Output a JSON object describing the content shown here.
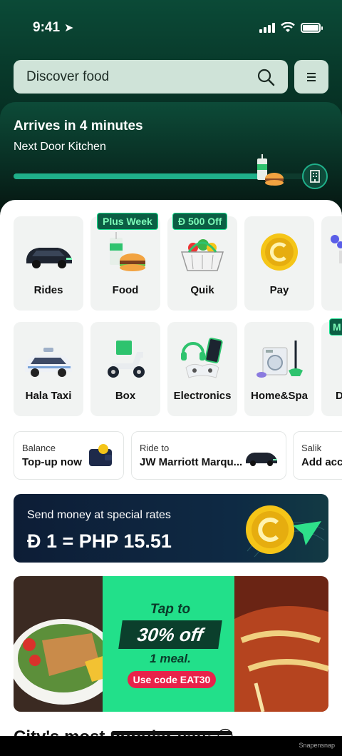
{
  "status_bar": {
    "time": "9:41"
  },
  "search": {
    "placeholder": "Discover food"
  },
  "order": {
    "title": "Arrives in 4 minutes",
    "subtitle": "Next Door Kitchen",
    "progress": 0.86
  },
  "services_row1": [
    {
      "label": "Rides",
      "icon": "car-icon",
      "badge": ""
    },
    {
      "label": "Food",
      "icon": "burger-meal-icon",
      "badge": "Plus Week"
    },
    {
      "label": "Quik",
      "icon": "grocery-basket-icon",
      "badge": "Ð 500 Off"
    },
    {
      "label": "Pay",
      "icon": "coin-icon",
      "badge": ""
    },
    {
      "label": "",
      "icon": "flowers-icon",
      "badge": ""
    }
  ],
  "services_row2": [
    {
      "label": "Hala Taxi",
      "icon": "taxi-icon"
    },
    {
      "label": "Box",
      "icon": "delivery-scooter-icon"
    },
    {
      "label": "Electronics",
      "icon": "electronics-icon"
    },
    {
      "label": "Home&Spa",
      "icon": "washing-machine-icon"
    },
    {
      "label": "D",
      "icon": "partial-tile-icon",
      "badge": "M"
    }
  ],
  "quick_actions": [
    {
      "key": "Balance",
      "value": "Top-up now",
      "icon": "wallet-icon"
    },
    {
      "key": "Ride to",
      "value": "JW Marriott Marqu...",
      "icon": "car-icon"
    },
    {
      "key": "Salik",
      "value": "Add acc",
      "icon": ""
    }
  ],
  "money_banner": {
    "line1": "Send money at special rates",
    "line2": "Ð 1 = PHP 15.51"
  },
  "promo": {
    "line1": "Tap to",
    "line2": "30% off",
    "line3": "1 meal.",
    "code": "Use code EAT30"
  },
  "section": {
    "title": "City's most popular eats 😊"
  },
  "footer": {
    "watermark": "Snapensnap"
  },
  "colors": {
    "brand_green": "#22e08a",
    "dark_green": "#0b4a37",
    "promo_red": "#e8224a"
  }
}
